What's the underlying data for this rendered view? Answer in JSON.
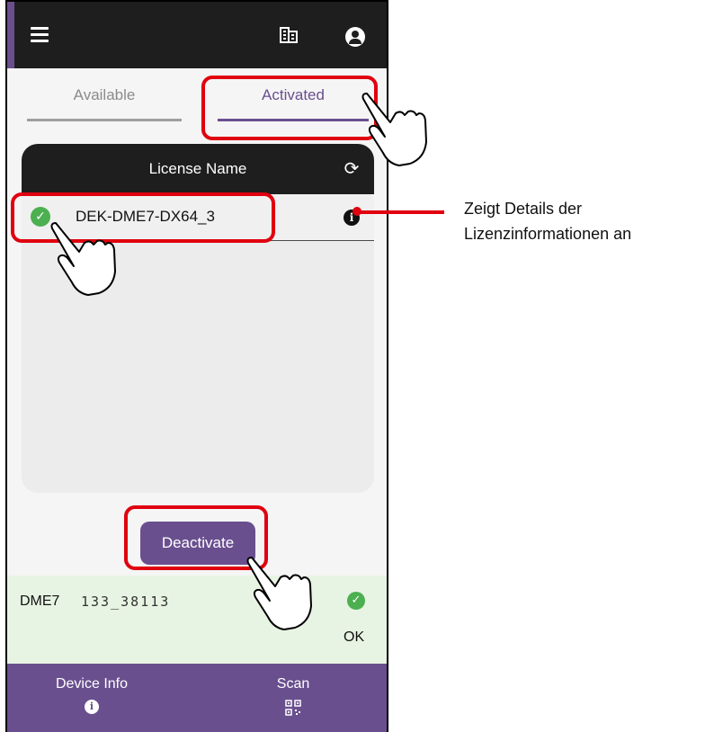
{
  "appbar": {
    "menu_icon": "hamburger-menu-icon",
    "building_icon": "building-icon",
    "account_icon": "account-circle-icon"
  },
  "tabs": [
    {
      "label": "Available",
      "active": false
    },
    {
      "label": "Activated",
      "active": true
    }
  ],
  "license_panel": {
    "header": "License Name",
    "refresh_icon": "refresh-icon",
    "rows": [
      {
        "name": "DEK-DME7-DX64_3",
        "status_icon": "check-circle-icon",
        "info_icon": "info-icon"
      }
    ]
  },
  "deactivate_label": "Deactivate",
  "device": {
    "name": "DME7",
    "serial": "1ЗЗ_38113",
    "status": "OK"
  },
  "bottom_nav": [
    {
      "label": "Device Info",
      "icon": "info-icon"
    },
    {
      "label": "Scan",
      "icon": "qr-code-icon"
    }
  ],
  "callout": {
    "line1": "Zeigt Details der",
    "line2": "Lizenzinformationen an"
  },
  "colors": {
    "accent": "#6a4f8f",
    "highlight": "#e0000f",
    "ok_green": "#4caf50",
    "appbar": "#1e1e1e"
  }
}
